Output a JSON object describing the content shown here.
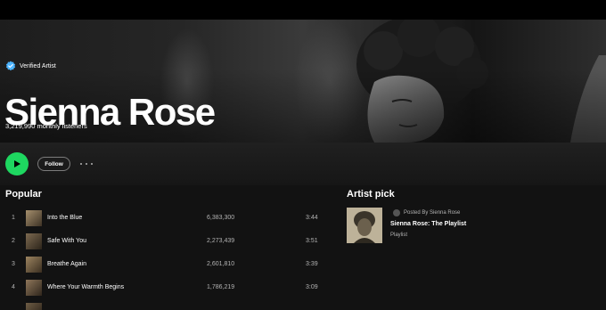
{
  "artist": {
    "verified_label": "Verified Artist",
    "name": "Sienna Rose",
    "monthly_listeners": "3,219,990 monthly listeners"
  },
  "actions": {
    "follow_label": "Follow"
  },
  "popular": {
    "title": "Popular",
    "tracks": [
      {
        "num": "1",
        "title": "Into the Blue",
        "plays": "6,383,300",
        "duration": "3:44"
      },
      {
        "num": "2",
        "title": "Safe With You",
        "plays": "2,273,439",
        "duration": "3:51"
      },
      {
        "num": "3",
        "title": "Breathe Again",
        "plays": "2,601,810",
        "duration": "3:39"
      },
      {
        "num": "4",
        "title": "Where Your Warmth Begins",
        "plays": "1,786,219",
        "duration": "3:09"
      }
    ]
  },
  "artist_pick": {
    "title": "Artist pick",
    "posted_by": "Posted By Sienna Rose",
    "name": "Sienna Rose: The Playlist",
    "type": "Playlist"
  },
  "colors": {
    "accent": "#1ed760",
    "verified": "#4cb3ff",
    "background": "#121212"
  },
  "icons": {
    "verified": "verified-badge-icon",
    "play": "play-icon",
    "more": "more-options-icon"
  }
}
